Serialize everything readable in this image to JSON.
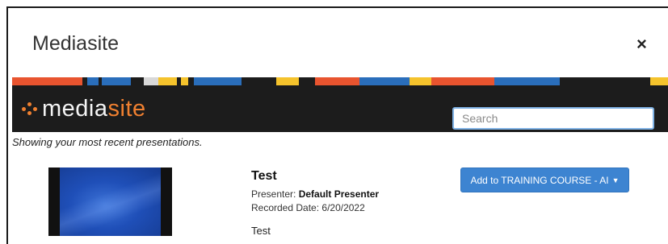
{
  "dialog": {
    "title": "Mediasite",
    "close_label": "×"
  },
  "header": {
    "logo_prefix": "media",
    "logo_suffix": "site",
    "search_placeholder": "Search",
    "search_value": ""
  },
  "colors": {
    "brand_orange": "#f08030",
    "header_bg": "#1c1c1c",
    "button_blue": "#3d84d1",
    "stripe": [
      "#e8542f",
      "#1c1c1c",
      "#2a6ebb",
      "#1c1c1c",
      "#f5c32c",
      "#1c1c1c",
      "#2a6ebb",
      "#f5c32c"
    ]
  },
  "list": {
    "recent_text": "Showing your most recent presentations."
  },
  "presentation": {
    "title": "Test",
    "presenter_label": "Presenter:",
    "presenter_name": "Default Presenter",
    "recorded_label": "Recorded Date:",
    "recorded_date": "6/20/2022",
    "description": "Test",
    "add_button_label": "Add to TRAINING COURSE - AI",
    "add_button_icon": "caret-down-icon"
  }
}
